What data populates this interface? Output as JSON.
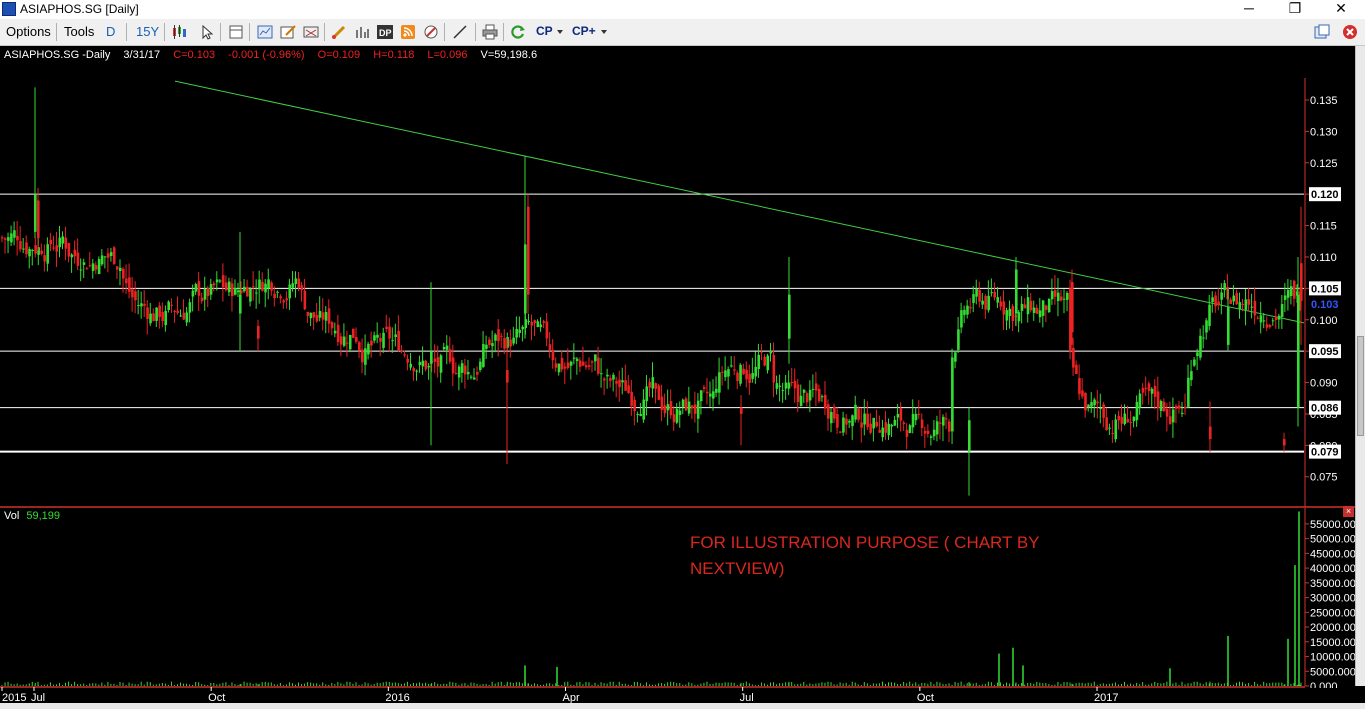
{
  "window": {
    "title": "ASIAPHOS.SG [Daily]",
    "minimize_glyph": "─",
    "maximize_glyph": "❐",
    "close_glyph": "✕"
  },
  "toolbar": {
    "options_label": "Options",
    "tools_label": "Tools",
    "period_label": "D",
    "range_label": "15Y",
    "cp_label": "CP",
    "cpplus_label": "CP+"
  },
  "info_bar": {
    "symbol": "ASIAPHOS.SG -Daily",
    "date": "3/31/17",
    "close": "C=0.103",
    "change": "-0.001 (-0.96%)",
    "open": "O=0.109",
    "high": "H=0.118",
    "low": "L=0.096",
    "volume": "V=59,198.6"
  },
  "volume_panel": {
    "label": "Vol",
    "value": "59,199"
  },
  "annotation": "FOR ILLUSTRATION PURPOSE ( CHART BY NEXTVIEW)",
  "colors": {
    "up": "#33dd33",
    "down": "#ee2222",
    "trendline": "#44cc44",
    "hline": "#ffffff"
  },
  "chart_data": [
    {
      "type": "candlestick",
      "title": "ASIAPHOS.SG -Daily",
      "x_tick_labels": [
        "2015",
        "Jul",
        "Oct",
        "2016",
        "Apr",
        "Jul",
        "Oct",
        "2017"
      ],
      "y_tick_labels": [
        "0.075",
        "0.080",
        "0.085",
        "0.090",
        "0.095",
        "0.100",
        "0.105",
        "0.110",
        "0.115",
        "0.120",
        "0.125",
        "0.130",
        "0.135"
      ],
      "ylim": [
        0.0705,
        0.1385
      ],
      "horizontal_lines": [
        0.12,
        0.105,
        0.095,
        0.086,
        0.079
      ],
      "horizontal_line_labels": [
        "0.120",
        "0.105",
        "0.095",
        "0.086",
        "0.079"
      ],
      "last_price_label": "0.103",
      "trendline": {
        "start": [
          "2015-09",
          0.138
        ],
        "end": [
          "2017-03",
          0.0995
        ]
      },
      "ohlc_sampled": [
        {
          "period": "Jul 2015",
          "high": 0.137,
          "low": 0.108,
          "close": 0.113
        },
        {
          "period": "Aug 2015",
          "high": 0.117,
          "low": 0.107,
          "close": 0.11
        },
        {
          "period": "Sep 2015",
          "high": 0.108,
          "low": 0.097,
          "close": 0.101
        },
        {
          "period": "Oct 2015",
          "high": 0.112,
          "low": 0.095,
          "close": 0.104
        },
        {
          "period": "Nov 2015",
          "high": 0.112,
          "low": 0.101,
          "close": 0.107
        },
        {
          "period": "Dec 2015",
          "high": 0.106,
          "low": 0.09,
          "close": 0.099
        },
        {
          "period": "Jan 2016",
          "high": 0.107,
          "low": 0.08,
          "close": 0.095
        },
        {
          "period": "Feb 2016",
          "high": 0.099,
          "low": 0.077,
          "close": 0.092
        },
        {
          "period": "Mar 2016",
          "high": 0.126,
          "low": 0.085,
          "close": 0.097
        },
        {
          "period": "Apr 2016",
          "high": 0.107,
          "low": 0.087,
          "close": 0.093
        },
        {
          "period": "May 2016",
          "high": 0.095,
          "low": 0.084,
          "close": 0.088
        },
        {
          "period": "Jun 2016",
          "high": 0.09,
          "low": 0.08,
          "close": 0.086
        },
        {
          "period": "Jul 2016",
          "high": 0.11,
          "low": 0.088,
          "close": 0.093
        },
        {
          "period": "Aug 2016",
          "high": 0.091,
          "low": 0.083,
          "close": 0.087
        },
        {
          "period": "Sep 2016",
          "high": 0.088,
          "low": 0.081,
          "close": 0.084
        },
        {
          "period": "Oct 2016",
          "high": 0.086,
          "low": 0.072,
          "close": 0.083
        },
        {
          "period": "Nov 2016",
          "high": 0.11,
          "low": 0.093,
          "close": 0.103
        },
        {
          "period": "Dec 2016",
          "high": 0.108,
          "low": 0.093,
          "close": 0.101
        },
        {
          "period": "Jan 2017",
          "high": 0.096,
          "low": 0.08,
          "close": 0.084
        },
        {
          "period": "Feb 2017",
          "high": 0.09,
          "low": 0.08,
          "close": 0.086
        },
        {
          "period": "Mar 2017",
          "high": 0.118,
          "low": 0.079,
          "close": 0.103
        }
      ]
    },
    {
      "type": "bar",
      "title": "Vol",
      "y_tick_labels": [
        "0.000",
        "5000.000",
        "10000.000",
        "15000.000",
        "20000.000",
        "25000.000",
        "30000.000",
        "35000.000",
        "40000.000",
        "45000.000",
        "50000.000",
        "55000.000"
      ],
      "ylim": [
        0,
        57000
      ],
      "last_value": 59199,
      "sampled_spikes": [
        {
          "period": "Mar 2016",
          "value": 7000
        },
        {
          "period": "Nov 2016",
          "value": 13000
        },
        {
          "period": "Jan 2017",
          "value": 6000
        },
        {
          "period": "Feb 2017",
          "value": 17000
        },
        {
          "period": "Mar 2017",
          "value": 59199
        }
      ]
    }
  ]
}
